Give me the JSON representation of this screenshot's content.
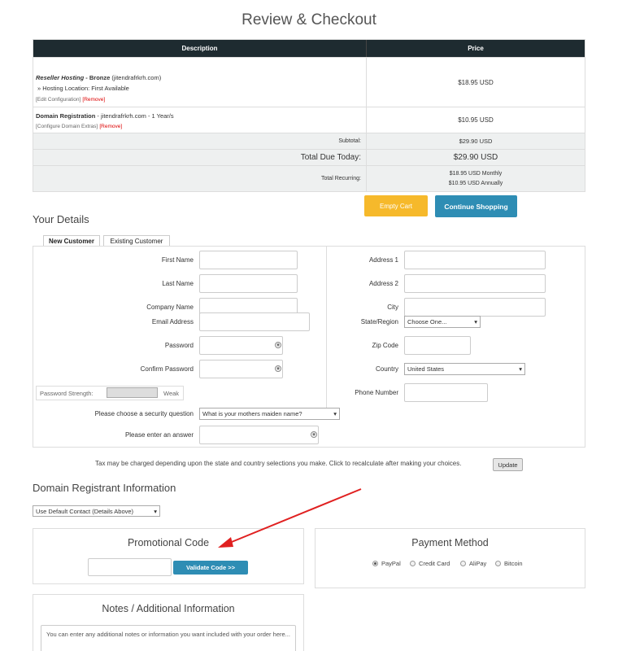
{
  "page": {
    "title": "Review & Checkout"
  },
  "cart": {
    "header": {
      "description": "Description",
      "price": "Price"
    },
    "items": [
      {
        "product": "Reseller Hosting",
        "plan": " - Bronze",
        "domain": " (jitendrafrkrh.com)",
        "detail": "» Hosting Location: First Available",
        "edit_link": "[Edit Configuration]",
        "remove_link": "[Remove]",
        "price": "$18.95 USD"
      },
      {
        "product": "Domain Registration",
        "domain": " - jitendrafrkrh.com - 1 Year/s",
        "edit_link": "[Configure Domain Extras]",
        "remove_link": "[Remove]",
        "price": "$10.95 USD"
      }
    ],
    "subtotal_label": "Subtotal:",
    "subtotal_value": "$29.90 USD",
    "total_label": "Total Due Today:",
    "total_value": "$29.90 USD",
    "recurring_label": "Total Recurring:",
    "recurring_monthly": "$18.95 USD Monthly",
    "recurring_annually": "$10.95 USD Annually"
  },
  "buttons": {
    "empty_cart": "Empty Cart",
    "continue_shopping": "Continue Shopping",
    "update": "Update",
    "validate_code": "Validate Code >>"
  },
  "your_details": {
    "title": "Your Details",
    "tabs": [
      "New Customer",
      "Existing Customer"
    ],
    "left_fields": {
      "first_name": "First Name",
      "last_name": "Last Name",
      "company_name": "Company Name",
      "email": "Email Address",
      "password": "Password",
      "confirm_password": "Confirm Password"
    },
    "right_fields": {
      "address1": "Address 1",
      "address2": "Address 2",
      "city": "City",
      "state": "State/Region",
      "zip": "Zip Code",
      "country": "Country",
      "phone": "Phone Number"
    },
    "state_value": "Choose One...",
    "country_value": "United States",
    "password_strength_label": "Password Strength:",
    "password_strength_value": "Weak",
    "security_question_label": "Please choose a security question",
    "security_question_value": "What is your mothers maiden name?",
    "answer_label": "Please enter an answer"
  },
  "tax_note": "Tax may be charged depending upon the state and country selections you make. Click to recalculate after making your choices.",
  "domain_registrant": {
    "title": "Domain Registrant Information",
    "select_value": "Use Default Contact (Details Above)"
  },
  "promo": {
    "title": "Promotional Code"
  },
  "payment": {
    "title": "Payment Method",
    "options": [
      "PayPal",
      "Credit Card",
      "AliPay",
      "Bitcoin"
    ],
    "selected": "PayPal"
  },
  "notes": {
    "title": "Notes / Additional Information",
    "placeholder": "You can enter any additional notes or information you want included with your order here..."
  },
  "colors": {
    "table_header": "#1e2b30",
    "empty_cart": "#f6b92b",
    "primary_button": "#2e8db4",
    "annotation_arrow": "#e02020"
  }
}
